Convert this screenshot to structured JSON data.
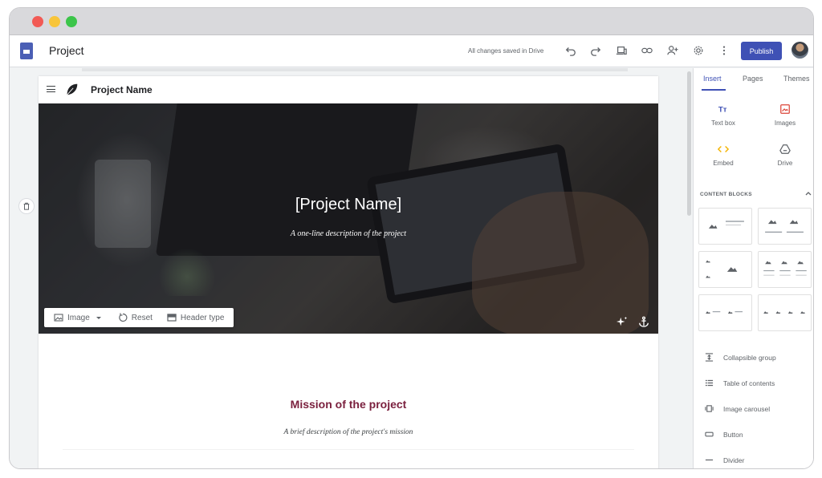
{
  "app": {
    "title": "Project",
    "save_status": "All changes saved in Drive",
    "publish_label": "Publish"
  },
  "toolbar": {
    "icons": [
      "undo-icon",
      "redo-icon",
      "preview-icon",
      "link-icon",
      "share-icon",
      "settings-icon",
      "more-icon"
    ]
  },
  "site": {
    "name": "Project Name",
    "hero": {
      "title": "[Project Name]",
      "subtitle": "A one-line description of the project"
    },
    "hero_tools": {
      "image_label": "Image",
      "reset_label": "Reset",
      "header_type_label": "Header type"
    },
    "mission": {
      "title": "Mission of the project",
      "subtitle": "A brief description of the project's mission"
    }
  },
  "sidebar": {
    "tabs": [
      "Insert",
      "Pages",
      "Themes"
    ],
    "active_tab": "Insert",
    "insert": {
      "text_box": "Text box",
      "images": "Images",
      "embed": "Embed",
      "drive": "Drive"
    },
    "content_blocks_label": "CONTENT BLOCKS",
    "list": {
      "collapsible": "Collapsible group",
      "toc": "Table of contents",
      "carousel": "Image carousel",
      "button": "Button",
      "divider": "Divider"
    }
  },
  "colors": {
    "accent": "#3f51b5",
    "mission_title": "#7a1f3d",
    "embed": "#f4b400",
    "images": "#db4437"
  }
}
